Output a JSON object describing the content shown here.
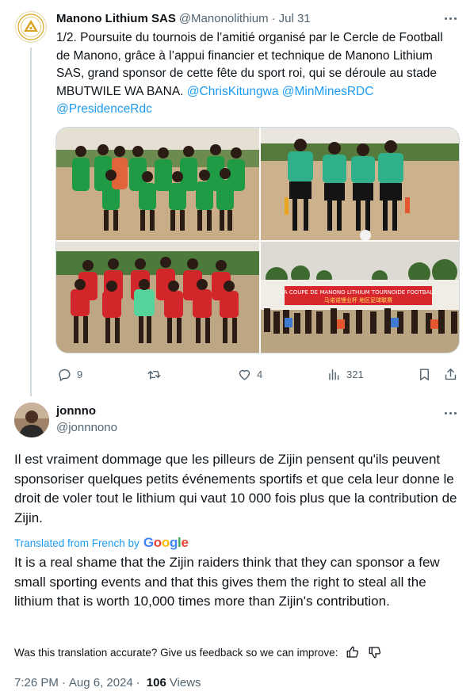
{
  "parent_tweet": {
    "author_name": "Manono Lithium SAS",
    "author_handle": "@Manonolithium",
    "separator": "·",
    "date": "Jul 31",
    "text_plain": "1/2. Poursuite du tournois de l’amitié organisé par le Cercle de Football de Manono, grâce à l’appui financier et technique de Manono Lithium SAS, grand sponsor de cette fête du sport roi, qui se déroule au stade MBUTWILE WA BANA.",
    "mentions": [
      "@ChrisKitungwa",
      "@MinMinesRDC",
      "@PresidenceRdc"
    ],
    "photos": [
      {
        "icon": "team-green-photo"
      },
      {
        "icon": "referees-photo"
      },
      {
        "icon": "team-red-photo"
      },
      {
        "icon": "crowd-banner-photo",
        "banner_text": "LA COUPE DE MANONO LITHIUM TOURNOIDE FOOTBALL",
        "banner_sub": "马诺诺锂业杯 地区足球联赛"
      }
    ],
    "actions": {
      "replies": "9",
      "retweets": "",
      "likes": "4",
      "views": "321"
    }
  },
  "reply": {
    "author_name": "jonnno",
    "author_handle": "@jonnnono",
    "text_original": "Il est vraiment dommage que les pilleurs de Zijin pensent qu'ils peuvent sponsoriser quelques petits événements sportifs et que cela leur donne le droit de voler tout le lithium qui vaut 10 000 fois plus que la contribution de Zijin.",
    "translated_from": "Translated from French by",
    "translator": "Google",
    "text_translated": "It is a real shame that the Zijin raiders think that they can sponsor a few small sporting events and that this gives them the right to steal all the lithium that is worth 10,000 times more than Zijin's contribution.",
    "feedback_prompt": "Was this translation accurate? Give us feedback so we can improve:",
    "time": "7:26 PM",
    "date": "Aug 6, 2024",
    "views_count": "106",
    "views_label": "Views"
  },
  "colors": {
    "link": "#1d9bf0",
    "secondary_text": "#536471",
    "primary_text": "#0f1419",
    "border": "#cfd9de"
  }
}
